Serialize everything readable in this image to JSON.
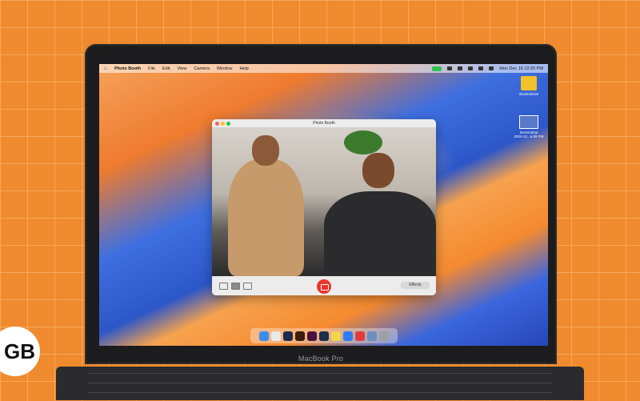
{
  "menubar": {
    "apple_icon": "apple-icon",
    "app_name": "Photo Booth",
    "items": [
      "File",
      "Edit",
      "View",
      "Camera",
      "Window",
      "Help"
    ],
    "clock": "Mon Dec 16  12:20 PM"
  },
  "desktop": {
    "drive_label": "iGeeksDrive",
    "screenshot_label_1": "Screenshot",
    "screenshot_label_2": "2024-12...6.09 PM"
  },
  "window": {
    "title": "Photo Booth",
    "effects_label": "Effects"
  },
  "device": {
    "model": "MacBook Pro"
  },
  "watermark": {
    "text": "GB"
  },
  "colors": {
    "accent_shutter": "#e8352d",
    "camera_indicator": "#2fc24f"
  }
}
